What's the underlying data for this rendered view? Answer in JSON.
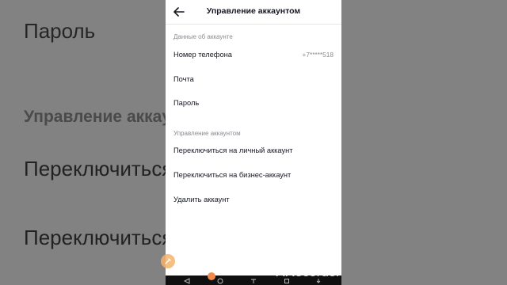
{
  "background": {
    "password": "Пароль",
    "manage": "Управление аккау",
    "switch_personal": "Переключиться",
    "switch_business": "Переключиться"
  },
  "header": {
    "title": "Управление аккаунтом",
    "back_icon": "arrow-left-icon"
  },
  "sections": {
    "account_data": {
      "title": "Данные об аккаунте",
      "items": [
        {
          "label": "Номер телефона",
          "value": "+7*****518"
        },
        {
          "label": "Почта"
        },
        {
          "label": "Пароль"
        }
      ]
    },
    "account_management": {
      "title": "Управление аккаунтом",
      "items": [
        {
          "label": "Переключиться на личный аккаунт"
        },
        {
          "label": "Переключиться на бизнес-аккаунт"
        },
        {
          "label": "Удалить аккаунт"
        }
      ]
    }
  },
  "navbar": {
    "icons": [
      "back-triangle-icon",
      "home-circle-icon",
      "menu-icon",
      "recents-square-icon",
      "download-icon"
    ]
  },
  "watermark": "XRecorder",
  "colors": {
    "text_primary": "#161823",
    "text_secondary": "#8a8b91",
    "recorder_accent": "#f5b36a"
  }
}
